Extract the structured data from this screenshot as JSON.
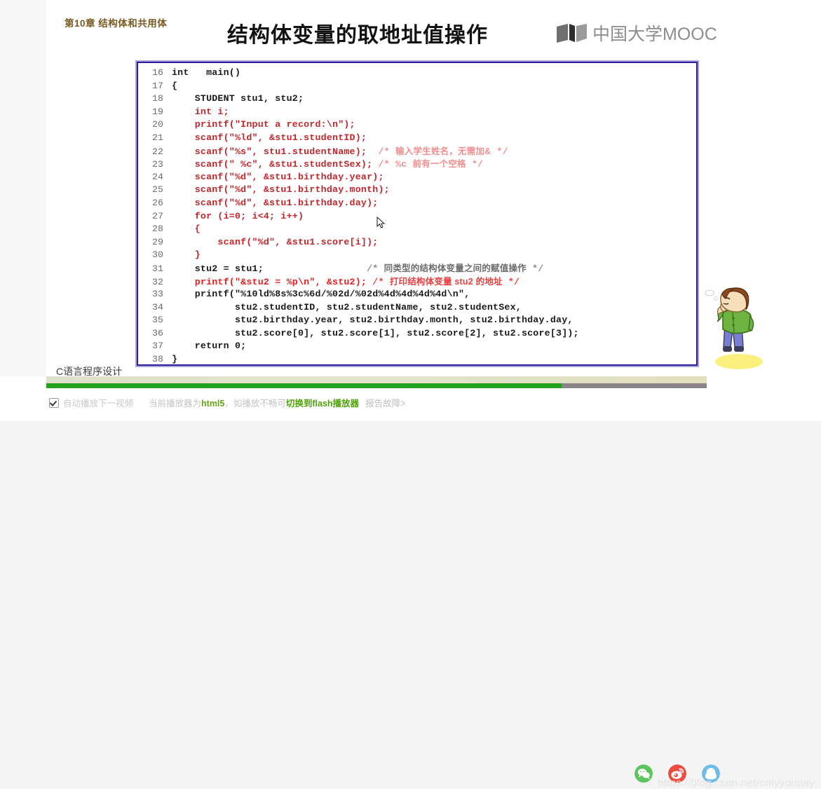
{
  "slide": {
    "chapter_label": "第10章 结构体和共用体",
    "title": "结构体变量的取地址值操作",
    "course_name": "C语言程序设计",
    "logo": {
      "icon": "book-logo-icon",
      "brand": "中国大学MOOC"
    }
  },
  "code": {
    "lines": [
      {
        "no": "16",
        "segments": [
          {
            "text": "int   main()",
            "style": "c-dark"
          }
        ]
      },
      {
        "no": "17",
        "segments": [
          {
            "text": "{",
            "style": "c-dark"
          }
        ]
      },
      {
        "no": "18",
        "segments": [
          {
            "text": "    STUDENT stu1, stu2;",
            "style": "c-dark"
          }
        ]
      },
      {
        "no": "19",
        "segments": [
          {
            "text": "    int i;",
            "style": "c-red"
          }
        ]
      },
      {
        "no": "20",
        "segments": [
          {
            "text": "    printf(\"Input a record:\\n\");",
            "style": "c-red"
          }
        ]
      },
      {
        "no": "21",
        "segments": [
          {
            "text": "    scanf(\"%ld\", &stu1.studentID);",
            "style": "c-red"
          }
        ]
      },
      {
        "no": "22",
        "segments": [
          {
            "text": "    scanf(\"%s\", stu1.studentName);  ",
            "style": "c-red"
          },
          {
            "text": "/* ",
            "style": "cmt-pink"
          },
          {
            "text": "输入学生姓名，无需加&",
            "style": "cmt-cn-pink"
          },
          {
            "text": " */",
            "style": "cmt-pink"
          }
        ]
      },
      {
        "no": "23",
        "segments": [
          {
            "text": "    scanf(\" %c\", &stu1.studentSex); ",
            "style": "c-red"
          },
          {
            "text": "/* %c ",
            "style": "cmt-pink"
          },
          {
            "text": "前有一个空格",
            "style": "cmt-cn-pink"
          },
          {
            "text": " */",
            "style": "cmt-pink"
          }
        ]
      },
      {
        "no": "24",
        "segments": [
          {
            "text": "    scanf(\"%d\", &stu1.birthday.year);",
            "style": "c-red"
          }
        ]
      },
      {
        "no": "25",
        "segments": [
          {
            "text": "    scanf(\"%d\", &stu1.birthday.month);",
            "style": "c-red"
          }
        ]
      },
      {
        "no": "26",
        "segments": [
          {
            "text": "    scanf(\"%d\", &stu1.birthday.day);",
            "style": "c-red"
          }
        ]
      },
      {
        "no": "27",
        "segments": [
          {
            "text": "    for (i=0; i<4; i++)",
            "style": "c-red"
          }
        ]
      },
      {
        "no": "28",
        "segments": [
          {
            "text": "    {",
            "style": "c-red"
          }
        ]
      },
      {
        "no": "29",
        "segments": [
          {
            "text": "        scanf(\"%d\", &stu1.score[i]);",
            "style": "c-red"
          }
        ]
      },
      {
        "no": "30",
        "segments": [
          {
            "text": "    }",
            "style": "c-red"
          }
        ]
      },
      {
        "no": "31",
        "segments": [
          {
            "text": "    stu2 = stu1;                  ",
            "style": "c-dark"
          },
          {
            "text": "/* ",
            "style": "cmt-grey"
          },
          {
            "text": "同类型的结构体变量之间的赋值操作",
            "style": "cmt-cn-dark"
          },
          {
            "text": " */",
            "style": "cmt-grey"
          }
        ]
      },
      {
        "no": "32",
        "segments": [
          {
            "text": "    printf(\"&stu2 = %p\\n\", &stu2); ",
            "style": "c-hot"
          },
          {
            "text": "/* ",
            "style": "cmt-red"
          },
          {
            "text": "打印结构体变量 stu2 的地址",
            "style": "cmt-cn-red"
          },
          {
            "text": " */",
            "style": "cmt-red"
          }
        ]
      },
      {
        "no": "33",
        "segments": [
          {
            "text": "    printf(\"%10ld%8s%3c%6d/%02d/%02d%4d%4d%4d%4d\\n\",",
            "style": "c-dark"
          }
        ]
      },
      {
        "no": "34",
        "segments": [
          {
            "text": "           stu2.studentID, stu2.studentName, stu2.studentSex,",
            "style": "c-dark"
          }
        ]
      },
      {
        "no": "35",
        "segments": [
          {
            "text": "           stu2.birthday.year, stu2.birthday.month, stu2.birthday.day,",
            "style": "c-dark"
          }
        ]
      },
      {
        "no": "36",
        "segments": [
          {
            "text": "           stu2.score[0], stu2.score[1], stu2.score[2], stu2.score[3]);",
            "style": "c-dark"
          }
        ]
      },
      {
        "no": "37",
        "segments": [
          {
            "text": "    return 0;",
            "style": "c-dark"
          }
        ]
      },
      {
        "no": "38",
        "segments": [
          {
            "text": "}",
            "style": "c-dark"
          }
        ]
      }
    ]
  },
  "cartoon": {
    "name": "thinking-boy-illustration",
    "hair_color": "#8d4a1f",
    "shirt_color": "#6db33f",
    "pants_color": "#7b7fd4",
    "skin_color": "#f6dfb8",
    "shadow_color": "#fbf07e"
  },
  "controls": {
    "progress_percent": 78,
    "progress_fill_color": "#23a31d",
    "progress_track_color": "#8a8488",
    "autoplay": {
      "checked": true,
      "label": "自动播放下一视频"
    },
    "player_note": {
      "prefix": "当前播放器为",
      "engine": "html5",
      "middle": "，如播放不畅可",
      "flash_link": "切换到flash播放器",
      "report_link": "报告故障>"
    },
    "socials": [
      {
        "name": "wechat-icon",
        "color": "#5ec45e"
      },
      {
        "name": "weibo-icon",
        "color": "#ec4b41"
      },
      {
        "name": "qq-icon",
        "color": "#6fbce8"
      }
    ]
  },
  "watermark": "https://blog.csdn.net/onlyyoupay"
}
